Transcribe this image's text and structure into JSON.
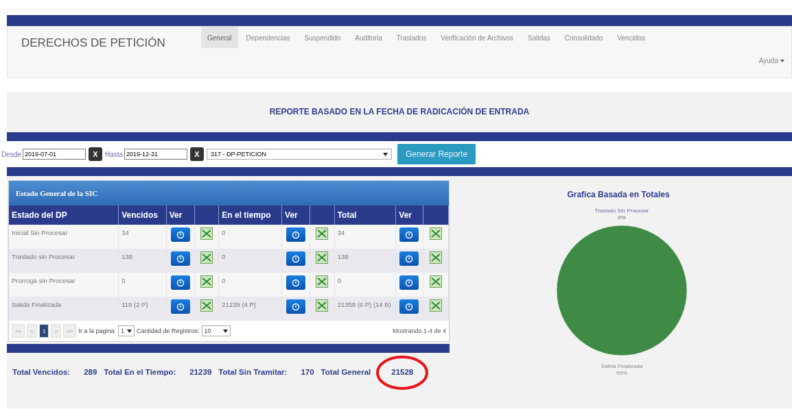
{
  "navbar": {
    "brand": "DERECHOS DE PETICIÓN",
    "tabs": [
      {
        "label": "General",
        "selected": true
      },
      {
        "label": "Dependencias",
        "selected": false
      },
      {
        "label": "Suspendido",
        "selected": false
      },
      {
        "label": "Auditoria",
        "selected": false
      },
      {
        "label": "Traslados",
        "selected": false
      },
      {
        "label": "Verificación de Archivos",
        "selected": false
      },
      {
        "label": "Salidas",
        "selected": false
      },
      {
        "label": "Consolidado",
        "selected": false
      },
      {
        "label": "Vencidos",
        "selected": false
      }
    ],
    "help_menu": "Ayuda"
  },
  "report": {
    "title": "REPORTE BASADO EN LA FECHA DE RADICACIÓN DE ENTRADA",
    "filters": {
      "from_label": "Desde",
      "from_value": "2019-07-01",
      "clear": "X",
      "to_label": "Hasta",
      "to_value": "2019-12-31",
      "clear_2": "X",
      "dependency": "317 - DP-PETICION",
      "button": "Generar Reporte"
    }
  },
  "table": {
    "title": "Estado General de la SIC",
    "columns": [
      "Estado del DP",
      "Vencidos",
      "Ver",
      "",
      "En el tiempo",
      "Ver",
      "",
      "Total",
      "Ver",
      ""
    ],
    "rows": [
      {
        "estado": "Inicial Sin Procesar",
        "vencidos": "34",
        "en_el_tiempo": "0",
        "total": "34"
      },
      {
        "estado": "Traslado sin Procesar",
        "vencidos": "138",
        "en_el_tiempo": "0",
        "total": "138"
      },
      {
        "estado": "Prorroga sin Procesar",
        "vencidos": "0",
        "en_el_tiempo": "0",
        "total": "0"
      },
      {
        "estado": "Salida Finalizada",
        "vencidos": "119 (2 P)",
        "en_el_tiempo": "21239 (4 P)",
        "total": "21358 (6 P) (14 B)"
      }
    ],
    "pager": {
      "buttons": [
        {
          "label": "<<",
          "selected": false
        },
        {
          "label": "<",
          "selected": false
        },
        {
          "label": "1",
          "selected": true
        },
        {
          "label": ">",
          "selected": false
        },
        {
          "label": ">>",
          "selected": false
        }
      ],
      "goto_label": "Ir a la pagina:",
      "goto_value": "1",
      "size_label": "Cantidad de Registros:",
      "size_value": "10",
      "showing": "Mostrando 1-4 de 4"
    }
  },
  "totals": [
    {
      "label": "Total Vencidos:",
      "value": "289"
    },
    {
      "label": "Total En el Tiempo:",
      "value": "21239"
    },
    {
      "label": "Total Sin Tramitar:",
      "value": "170"
    },
    {
      "label": "Total General",
      "value": "21528",
      "highlighted": true
    }
  ],
  "chart": {
    "title": "Grafica Basada en Totales",
    "chart_data": {
      "type": "pie",
      "categories": [
        "Traslado Sin Procesar",
        "Salida Finalizada"
      ],
      "values": [
        0,
        99
      ],
      "value_labels": [
        "0%",
        "99%"
      ]
    }
  }
}
